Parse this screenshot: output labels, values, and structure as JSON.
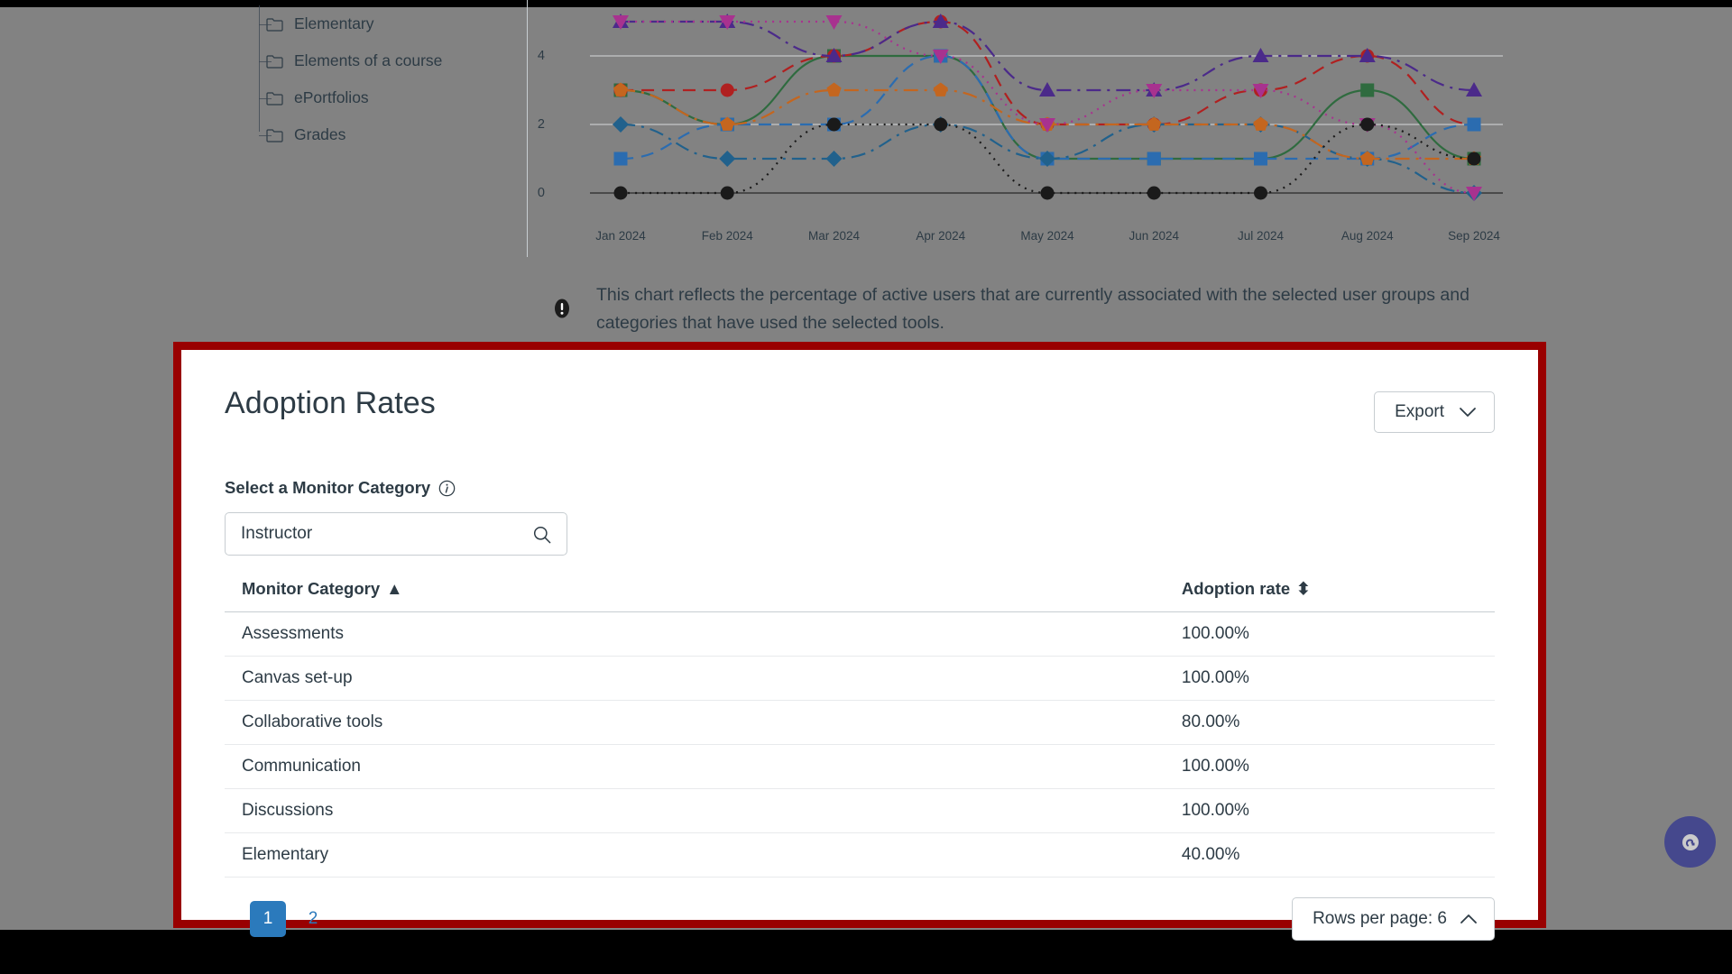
{
  "tree": {
    "items": [
      {
        "label": "Elementary",
        "icon": "folder-icon"
      },
      {
        "label": "Elements of a course",
        "icon": "folder-icon"
      },
      {
        "label": "ePortfolios",
        "icon": "folder-icon"
      },
      {
        "label": "Grades",
        "icon": "folder-icon"
      }
    ]
  },
  "info_note": {
    "icon": "alert-info-icon",
    "text": "This chart reflects the percentage of active users that are currently associated with the selected user groups and categories that have used the selected tools."
  },
  "card": {
    "title": "Adoption Rates",
    "export_label": "Export",
    "export_icon": "chevron-down-icon",
    "field_label": "Select a Monitor Category",
    "field_info_icon": "info-circle-icon",
    "search": {
      "value": "Instructor",
      "placeholder": "Search",
      "icon": "search-icon"
    },
    "table": {
      "columns": [
        {
          "label": "Monitor Category",
          "sort": "▲",
          "sort_state": "ascending"
        },
        {
          "label": "Adoption rate",
          "sort": "⬍",
          "sort_state": "none"
        }
      ],
      "rows": [
        {
          "category": "Assessments",
          "rate": "100.00%"
        },
        {
          "category": "Canvas set-up",
          "rate": "100.00%"
        },
        {
          "category": "Collaborative tools",
          "rate": "80.00%"
        },
        {
          "category": "Communication",
          "rate": "100.00%"
        },
        {
          "category": "Discussions",
          "rate": "100.00%"
        },
        {
          "category": "Elementary",
          "rate": "40.00%"
        }
      ]
    },
    "pagination": {
      "pages": [
        "1",
        "2"
      ],
      "current": "1"
    },
    "rows_per_page": {
      "label": "Rows per page: 6",
      "icon": "chevron-up-icon"
    }
  },
  "help": {
    "icon": "help-chat-icon"
  },
  "colors": {
    "accent_blue": "#2b7abc",
    "highlight_border": "#990000",
    "text": "#2d3b45",
    "page_dim": "#828282",
    "help_fab": "#3b3f8f"
  },
  "chart_data": {
    "type": "line",
    "title": "",
    "xlabel": "",
    "ylabel": "",
    "x": [
      "Jan 2024",
      "Feb 2024",
      "Mar 2024",
      "Apr 2024",
      "May 2024",
      "Jun 2024",
      "Jul 2024",
      "Aug 2024",
      "Sep 2024"
    ],
    "yticks": [
      0,
      2,
      4
    ],
    "ylim": [
      0,
      5
    ],
    "grid": true,
    "legend": "none",
    "series": [
      {
        "name": "series-green-square",
        "color": "#2f6b3f",
        "dash": "solid",
        "marker": "square",
        "values": [
          3,
          2,
          4,
          4,
          1,
          1,
          1,
          3,
          1
        ]
      },
      {
        "name": "series-red-circle",
        "color": "#b02020",
        "dash": "dashed",
        "marker": "circle",
        "values": [
          3,
          3,
          4,
          5,
          2,
          2,
          3,
          4,
          2
        ]
      },
      {
        "name": "series-blue-square",
        "color": "#2b6cb0",
        "dash": "dashed",
        "marker": "square",
        "values": [
          1,
          2,
          2,
          4,
          1,
          1,
          1,
          1,
          2
        ]
      },
      {
        "name": "series-blue-diamond",
        "color": "#21618c",
        "dash": "dashdot",
        "marker": "diamond",
        "values": [
          2,
          1,
          1,
          2,
          1,
          2,
          2,
          1,
          0
        ]
      },
      {
        "name": "series-orange-pent",
        "color": "#c4661f",
        "dash": "dashdot",
        "marker": "pentagon",
        "values": [
          3,
          2,
          3,
          3,
          2,
          2,
          2,
          1,
          1
        ]
      },
      {
        "name": "series-purple-tri",
        "color": "#4b2a8a",
        "dash": "dashdot",
        "marker": "triangle",
        "values": [
          5,
          5,
          4,
          5,
          3,
          3,
          4,
          4,
          3
        ]
      },
      {
        "name": "series-magenta-tri",
        "color": "#a8328f",
        "dash": "dotted",
        "marker": "triangle-down",
        "values": [
          5,
          5,
          5,
          4,
          2,
          3,
          3,
          2,
          0
        ]
      },
      {
        "name": "series-black-circle",
        "color": "#1a1a1a",
        "dash": "dotted",
        "marker": "circle",
        "values": [
          0,
          0,
          2,
          2,
          0,
          0,
          0,
          2,
          1
        ]
      }
    ]
  }
}
